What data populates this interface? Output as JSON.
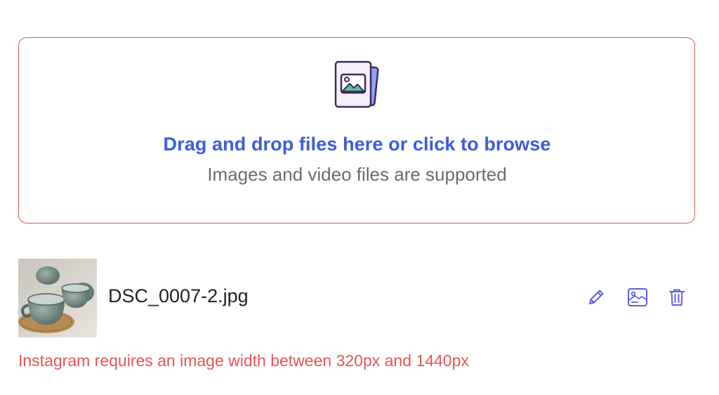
{
  "dropzone": {
    "title": "Drag and drop files here or click to browse",
    "subtitle": "Images and video files are supported",
    "icon": "image-upload-icon",
    "border_color": "#e5535b",
    "title_color": "#3d5bdb"
  },
  "file": {
    "name": "DSC_0007-2.jpg",
    "thumbnail_icon": "image-thumbnail",
    "actions": [
      {
        "name": "edit",
        "icon": "pencil-icon"
      },
      {
        "name": "preview",
        "icon": "image-icon"
      },
      {
        "name": "delete",
        "icon": "trash-icon"
      }
    ],
    "action_color": "#5b5fe0"
  },
  "error": {
    "message": "Instagram requires an image width between 320px and 1440px",
    "color": "#e5535b"
  }
}
